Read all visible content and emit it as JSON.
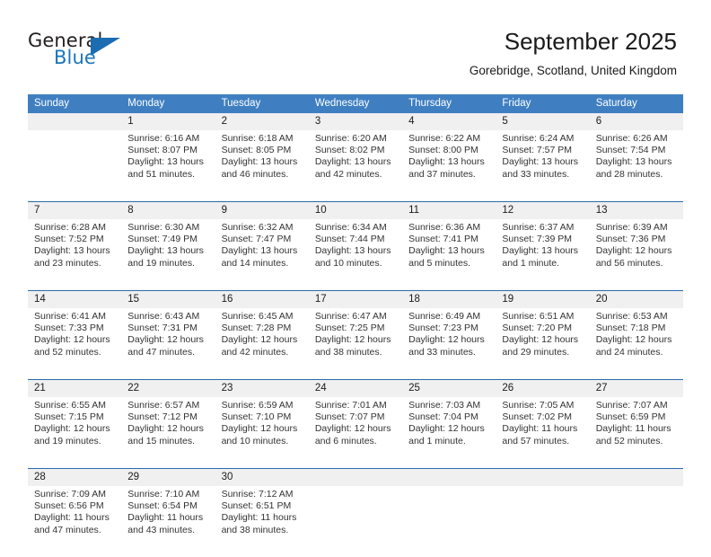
{
  "brand": {
    "name_part1": "General",
    "name_part2": "Blue",
    "flag_icon": "triangle-flag-icon"
  },
  "header": {
    "title": "September 2025",
    "subtitle": "Gorebridge, Scotland, United Kingdom"
  },
  "colors": {
    "header_blue": "#3f7fc1",
    "separator_blue": "#2b6cb0",
    "daynum_band": "#f0f0f0",
    "brand_blue": "#1b75bb",
    "text": "#333333"
  },
  "weekday_headers": [
    "Sunday",
    "Monday",
    "Tuesday",
    "Wednesday",
    "Thursday",
    "Friday",
    "Saturday"
  ],
  "weeks": [
    {
      "days": [
        {
          "num": "",
          "sunrise": "",
          "sunset": "",
          "daylight_line1": "",
          "daylight_line2": ""
        },
        {
          "num": "1",
          "sunrise": "Sunrise: 6:16 AM",
          "sunset": "Sunset: 8:07 PM",
          "daylight_line1": "Daylight: 13 hours",
          "daylight_line2": "and 51 minutes."
        },
        {
          "num": "2",
          "sunrise": "Sunrise: 6:18 AM",
          "sunset": "Sunset: 8:05 PM",
          "daylight_line1": "Daylight: 13 hours",
          "daylight_line2": "and 46 minutes."
        },
        {
          "num": "3",
          "sunrise": "Sunrise: 6:20 AM",
          "sunset": "Sunset: 8:02 PM",
          "daylight_line1": "Daylight: 13 hours",
          "daylight_line2": "and 42 minutes."
        },
        {
          "num": "4",
          "sunrise": "Sunrise: 6:22 AM",
          "sunset": "Sunset: 8:00 PM",
          "daylight_line1": "Daylight: 13 hours",
          "daylight_line2": "and 37 minutes."
        },
        {
          "num": "5",
          "sunrise": "Sunrise: 6:24 AM",
          "sunset": "Sunset: 7:57 PM",
          "daylight_line1": "Daylight: 13 hours",
          "daylight_line2": "and 33 minutes."
        },
        {
          "num": "6",
          "sunrise": "Sunrise: 6:26 AM",
          "sunset": "Sunset: 7:54 PM",
          "daylight_line1": "Daylight: 13 hours",
          "daylight_line2": "and 28 minutes."
        }
      ]
    },
    {
      "days": [
        {
          "num": "7",
          "sunrise": "Sunrise: 6:28 AM",
          "sunset": "Sunset: 7:52 PM",
          "daylight_line1": "Daylight: 13 hours",
          "daylight_line2": "and 23 minutes."
        },
        {
          "num": "8",
          "sunrise": "Sunrise: 6:30 AM",
          "sunset": "Sunset: 7:49 PM",
          "daylight_line1": "Daylight: 13 hours",
          "daylight_line2": "and 19 minutes."
        },
        {
          "num": "9",
          "sunrise": "Sunrise: 6:32 AM",
          "sunset": "Sunset: 7:47 PM",
          "daylight_line1": "Daylight: 13 hours",
          "daylight_line2": "and 14 minutes."
        },
        {
          "num": "10",
          "sunrise": "Sunrise: 6:34 AM",
          "sunset": "Sunset: 7:44 PM",
          "daylight_line1": "Daylight: 13 hours",
          "daylight_line2": "and 10 minutes."
        },
        {
          "num": "11",
          "sunrise": "Sunrise: 6:36 AM",
          "sunset": "Sunset: 7:41 PM",
          "daylight_line1": "Daylight: 13 hours",
          "daylight_line2": "and 5 minutes."
        },
        {
          "num": "12",
          "sunrise": "Sunrise: 6:37 AM",
          "sunset": "Sunset: 7:39 PM",
          "daylight_line1": "Daylight: 13 hours",
          "daylight_line2": "and 1 minute."
        },
        {
          "num": "13",
          "sunrise": "Sunrise: 6:39 AM",
          "sunset": "Sunset: 7:36 PM",
          "daylight_line1": "Daylight: 12 hours",
          "daylight_line2": "and 56 minutes."
        }
      ]
    },
    {
      "days": [
        {
          "num": "14",
          "sunrise": "Sunrise: 6:41 AM",
          "sunset": "Sunset: 7:33 PM",
          "daylight_line1": "Daylight: 12 hours",
          "daylight_line2": "and 52 minutes."
        },
        {
          "num": "15",
          "sunrise": "Sunrise: 6:43 AM",
          "sunset": "Sunset: 7:31 PM",
          "daylight_line1": "Daylight: 12 hours",
          "daylight_line2": "and 47 minutes."
        },
        {
          "num": "16",
          "sunrise": "Sunrise: 6:45 AM",
          "sunset": "Sunset: 7:28 PM",
          "daylight_line1": "Daylight: 12 hours",
          "daylight_line2": "and 42 minutes."
        },
        {
          "num": "17",
          "sunrise": "Sunrise: 6:47 AM",
          "sunset": "Sunset: 7:25 PM",
          "daylight_line1": "Daylight: 12 hours",
          "daylight_line2": "and 38 minutes."
        },
        {
          "num": "18",
          "sunrise": "Sunrise: 6:49 AM",
          "sunset": "Sunset: 7:23 PM",
          "daylight_line1": "Daylight: 12 hours",
          "daylight_line2": "and 33 minutes."
        },
        {
          "num": "19",
          "sunrise": "Sunrise: 6:51 AM",
          "sunset": "Sunset: 7:20 PM",
          "daylight_line1": "Daylight: 12 hours",
          "daylight_line2": "and 29 minutes."
        },
        {
          "num": "20",
          "sunrise": "Sunrise: 6:53 AM",
          "sunset": "Sunset: 7:18 PM",
          "daylight_line1": "Daylight: 12 hours",
          "daylight_line2": "and 24 minutes."
        }
      ]
    },
    {
      "days": [
        {
          "num": "21",
          "sunrise": "Sunrise: 6:55 AM",
          "sunset": "Sunset: 7:15 PM",
          "daylight_line1": "Daylight: 12 hours",
          "daylight_line2": "and 19 minutes."
        },
        {
          "num": "22",
          "sunrise": "Sunrise: 6:57 AM",
          "sunset": "Sunset: 7:12 PM",
          "daylight_line1": "Daylight: 12 hours",
          "daylight_line2": "and 15 minutes."
        },
        {
          "num": "23",
          "sunrise": "Sunrise: 6:59 AM",
          "sunset": "Sunset: 7:10 PM",
          "daylight_line1": "Daylight: 12 hours",
          "daylight_line2": "and 10 minutes."
        },
        {
          "num": "24",
          "sunrise": "Sunrise: 7:01 AM",
          "sunset": "Sunset: 7:07 PM",
          "daylight_line1": "Daylight: 12 hours",
          "daylight_line2": "and 6 minutes."
        },
        {
          "num": "25",
          "sunrise": "Sunrise: 7:03 AM",
          "sunset": "Sunset: 7:04 PM",
          "daylight_line1": "Daylight: 12 hours",
          "daylight_line2": "and 1 minute."
        },
        {
          "num": "26",
          "sunrise": "Sunrise: 7:05 AM",
          "sunset": "Sunset: 7:02 PM",
          "daylight_line1": "Daylight: 11 hours",
          "daylight_line2": "and 57 minutes."
        },
        {
          "num": "27",
          "sunrise": "Sunrise: 7:07 AM",
          "sunset": "Sunset: 6:59 PM",
          "daylight_line1": "Daylight: 11 hours",
          "daylight_line2": "and 52 minutes."
        }
      ]
    },
    {
      "days": [
        {
          "num": "28",
          "sunrise": "Sunrise: 7:09 AM",
          "sunset": "Sunset: 6:56 PM",
          "daylight_line1": "Daylight: 11 hours",
          "daylight_line2": "and 47 minutes."
        },
        {
          "num": "29",
          "sunrise": "Sunrise: 7:10 AM",
          "sunset": "Sunset: 6:54 PM",
          "daylight_line1": "Daylight: 11 hours",
          "daylight_line2": "and 43 minutes."
        },
        {
          "num": "30",
          "sunrise": "Sunrise: 7:12 AM",
          "sunset": "Sunset: 6:51 PM",
          "daylight_line1": "Daylight: 11 hours",
          "daylight_line2": "and 38 minutes."
        },
        {
          "num": "",
          "sunrise": "",
          "sunset": "",
          "daylight_line1": "",
          "daylight_line2": ""
        },
        {
          "num": "",
          "sunrise": "",
          "sunset": "",
          "daylight_line1": "",
          "daylight_line2": ""
        },
        {
          "num": "",
          "sunrise": "",
          "sunset": "",
          "daylight_line1": "",
          "daylight_line2": ""
        },
        {
          "num": "",
          "sunrise": "",
          "sunset": "",
          "daylight_line1": "",
          "daylight_line2": ""
        }
      ]
    }
  ]
}
